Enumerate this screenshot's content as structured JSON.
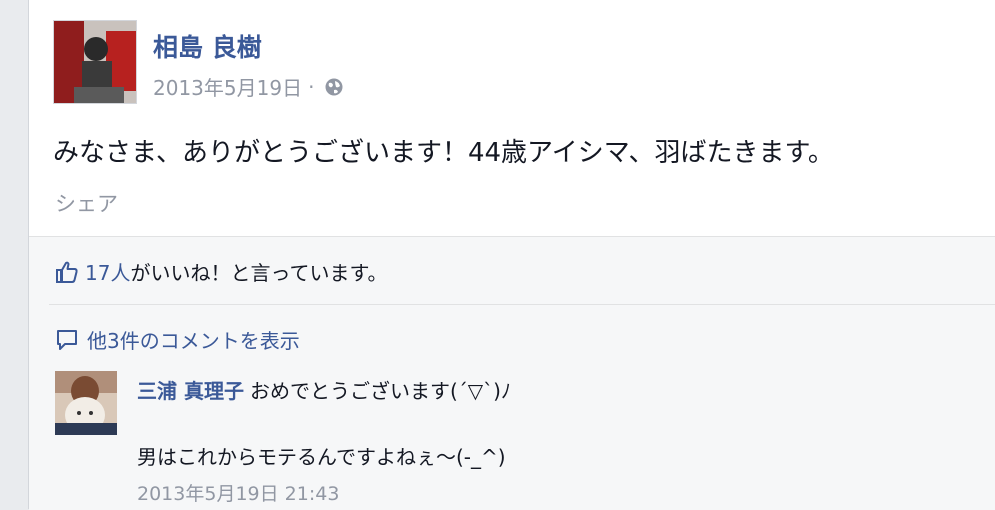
{
  "post": {
    "author": "相島 良樹",
    "date": "2013年5月19日",
    "separator": "·",
    "privacy_icon": "globe-icon",
    "message": "みなさま、ありがとうございます！44歳アイシマ、羽ばたきます。",
    "share_label": "シェア"
  },
  "ufi": {
    "likes_icon": "thumbs-up-icon",
    "likes_count": "17人",
    "likes_text": "がいいね！と言っています。",
    "view_comments_icon": "comment-bubble-icon",
    "view_comments_label": "他3件のコメントを表示"
  },
  "comment": {
    "author": "三浦 真理子",
    "text_line1": "おめでとうございます(´▽`)ﾉ",
    "text_line2": "男はこれからモテるんですよねぇ〜(-_^)",
    "timestamp": "2013年5月19日 21:43"
  },
  "colors": {
    "link": "#3b5998",
    "muted": "#9197a3",
    "ufi_background": "#f6f7f8"
  }
}
